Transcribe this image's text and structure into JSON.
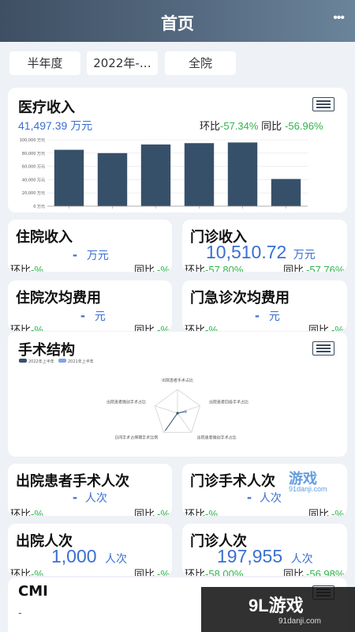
{
  "header": {
    "title": "首页",
    "more_icon": "more-dots-icon",
    "more_glyph": "•••"
  },
  "filters": {
    "period": "半年度",
    "date": "2022年-…",
    "dept": "全院"
  },
  "medical_income": {
    "title": "医疗收入",
    "value": "41,497.39",
    "unit": "万元",
    "hb_label": "环比",
    "hb_value": "-57.34%",
    "tb_label": "同比",
    "tb_value": "-56.96%",
    "menu_icon": "list-menu-icon"
  },
  "chart_data": {
    "type": "bar",
    "categories": [
      "",
      "",
      "",
      "",
      "",
      ""
    ],
    "values": [
      85000,
      80000,
      93000,
      95000,
      96000,
      41000
    ],
    "ylim": [
      0,
      100000
    ],
    "yticks": [
      "100,000 万元",
      "80,000 万元",
      "60,000 万元",
      "40,000 万元",
      "20,000 万元",
      "0 万元"
    ],
    "bar_color": "#37506a",
    "grid": true
  },
  "inpatient_income": {
    "title": "住院收入",
    "value": "-",
    "unit": "万元",
    "hb_label": "环比",
    "hb_value": "-%",
    "tb_label": "同比",
    "tb_value": "-%"
  },
  "outpatient_income": {
    "title": "门诊收入",
    "value": "10,510.72",
    "unit": "万元",
    "hb_label": "环比",
    "hb_value": "-57.80%",
    "tb_label": "同比",
    "tb_value": "-57.76%"
  },
  "inpatient_avg_cost": {
    "title": "住院次均费用",
    "value": "-",
    "unit": "元",
    "hb_label": "环比",
    "hb_value": "-%",
    "tb_label": "同比",
    "tb_value": "-%"
  },
  "emergency_avg_cost": {
    "title": "门急诊次均费用",
    "value": "-",
    "unit": "元",
    "hb_label": "环比",
    "hb_value": "-%",
    "tb_label": "同比",
    "tb_value": "-%"
  },
  "surgery_structure": {
    "title": "手术结构",
    "menu_icon": "list-menu-icon",
    "legend": [
      {
        "name": "2022年上半年",
        "color": "#37506a"
      },
      {
        "name": "2021年上半年",
        "color": "#7ea4e6"
      }
    ],
    "radar_labels": [
      "出院患者手术占比",
      "出院患者四级手术占比",
      "出院患者微创手术占比",
      "日间手术占择期手术比例",
      "出院患者微创手术占比"
    ]
  },
  "discharge_surgery": {
    "title": "出院患者手术人次",
    "value": "-",
    "unit": "人次",
    "hb_label": "环比",
    "hb_value": "-%",
    "tb_label": "同比",
    "tb_value": "-%"
  },
  "outpatient_surgery": {
    "title": "门诊手术人次",
    "value": "-",
    "unit": "人次",
    "hb_label": "环比",
    "hb_value": "-%",
    "tb_label": "同比",
    "tb_value": "-%"
  },
  "discharge_visits": {
    "title": "出院人次",
    "value": "1,000",
    "unit": "人次",
    "hb_label": "环比",
    "hb_value": "-%",
    "tb_label": "同比",
    "tb_value": "-%"
  },
  "outpatient_visits": {
    "title": "门诊人次",
    "value": "197,955",
    "unit": "人次",
    "hb_label": "环比",
    "hb_value": "-58.00%",
    "tb_label": "同比",
    "tb_value": "-56.98%"
  },
  "cmi": {
    "title": "CMI",
    "value": "-",
    "menu_icon": "list-menu-icon"
  },
  "watermark": {
    "text1": "游戏",
    "text2": "91danji.com",
    "text3": "9L游戏"
  }
}
